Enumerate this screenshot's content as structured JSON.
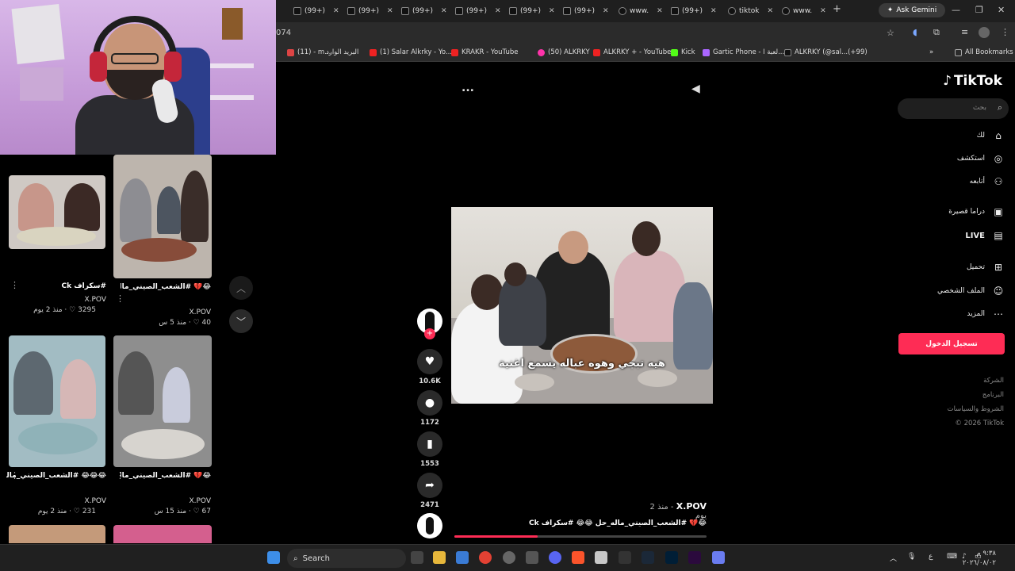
{
  "browser": {
    "tabs": [
      {
        "label": "(99+)"
      },
      {
        "label": "(99+)"
      },
      {
        "label": "(99+)"
      },
      {
        "label": "(99+)"
      },
      {
        "label": "(99+)"
      },
      {
        "label": "(99+)"
      },
      {
        "label": "www."
      },
      {
        "label": "(99+)"
      },
      {
        "label": "tiktok"
      },
      {
        "label": "www."
      }
    ],
    "new_tab": "+",
    "ask_gemini": "Ask Gemini",
    "address_text": "074",
    "bookmarks": [
      {
        "label": "(11) - m...",
        "icon": "gmail-icon"
      },
      {
        "label": "البريد الوارد",
        "icon": ""
      },
      {
        "label": "(1) Salar Alkrky - Yo...",
        "icon": "youtube-icon"
      },
      {
        "label": "KRAKR - YouTube",
        "icon": "youtube-icon"
      },
      {
        "label": "(50) ALKRKY",
        "icon": "kick-icon"
      },
      {
        "label": "ALKRKY + - YouTube",
        "icon": "youtube-icon"
      },
      {
        "label": "Kick",
        "icon": "kick-icon"
      },
      {
        "label": "Gartic Phone - لعبة ا...",
        "icon": "gartic-icon"
      },
      {
        "label": "ALKRKY (@sal...(+99)",
        "icon": "tiktok-icon"
      }
    ],
    "all_bookmarks": "All Bookmarks",
    "colors": {
      "accent": "#fe2c55"
    }
  },
  "left_grid": [
    {
      "title": "#سكراف Ck",
      "author": "X.POV",
      "likes": "3295",
      "age": "منذ 2 يوم"
    },
    {
      "title": "😂💔 #الشعب_الصيني_ماله_حل😂...",
      "author": "X.POV",
      "likes": "40",
      "age": "منذ 5 س"
    },
    {
      "title": "😂😂😂 #الشعب_الصيني_ماله_حل 🐹...",
      "author": "X.POV",
      "likes": "231",
      "age": "منذ 2 يوم"
    },
    {
      "title": "😂💔 #الشعب_الصيني_ماله_حل😂...",
      "author": "X.POV",
      "likes": "67",
      "age": "منذ 15 س"
    }
  ],
  "video": {
    "caption": "هيه تبجي وهوه عباله يسمع اغنية",
    "author": "X.POV",
    "age": "منذ 2 يوم",
    "description": "😂💔 #الشعب_الصيني_ماله_حل 😂😂 #سكراف Ck",
    "progress_fraction": 0.33,
    "menu": "...",
    "actions": [
      {
        "icon": "heart-icon",
        "count": "10.6K"
      },
      {
        "icon": "comment-icon",
        "count": "1172"
      },
      {
        "icon": "bookmark-icon",
        "count": "1553"
      },
      {
        "icon": "share-icon",
        "count": "2471"
      }
    ]
  },
  "sidebar": {
    "brand": "TikTok",
    "search_placeholder": "بحث",
    "nav": [
      {
        "label": "لك",
        "icon": "home-icon"
      },
      {
        "label": "استكشف",
        "icon": "compass-icon"
      },
      {
        "label": "أتابعه",
        "icon": "following-icon"
      },
      {
        "label": "دراما قصيرة",
        "icon": "drama-icon"
      },
      {
        "label": "LIVE",
        "icon": "live-icon"
      },
      {
        "label": "تحميل",
        "icon": "upload-icon"
      },
      {
        "label": "الملف الشخصي",
        "icon": "profile-icon"
      },
      {
        "label": "المزيد",
        "icon": "more-icon"
      }
    ],
    "login": "تسجيل الدخول",
    "footer": [
      "الشركة",
      "البرنامج",
      "الشروط والسياسات",
      "© 2026 TikTok"
    ]
  },
  "taskbar": {
    "search": "Search",
    "lang": "ع",
    "time": "٩:٣٨ م",
    "date": "٢٠٢٦/٠٨/٠٢"
  }
}
